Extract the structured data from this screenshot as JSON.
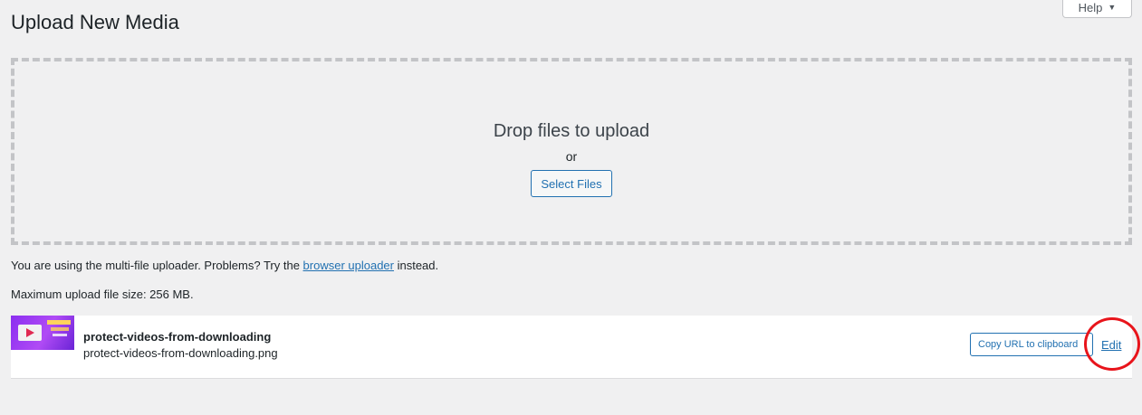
{
  "header": {
    "title": "Upload New Media",
    "help_label": "Help",
    "help_caret": "▼"
  },
  "dropzone": {
    "title": "Drop files to upload",
    "or_text": "or",
    "select_button": "Select Files"
  },
  "notes": {
    "uploader_prefix": "You are using the multi-file uploader. Problems? Try the ",
    "uploader_link": "browser uploader",
    "uploader_suffix": " instead.",
    "max_size": "Maximum upload file size: 256 MB."
  },
  "media_item": {
    "title": "protect-videos-from-downloading",
    "filename": "protect-videos-from-downloading.png",
    "copy_url_label": "Copy URL to clipboard",
    "edit_label": "Edit",
    "thumbnail_icon": "image-thumbnail"
  },
  "colors": {
    "link": "#2271b1",
    "annotation": "#e8141b",
    "background": "#f0f0f1"
  }
}
